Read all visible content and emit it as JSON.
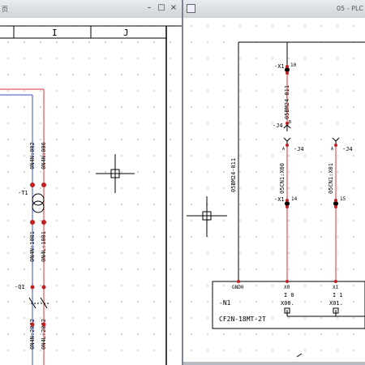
{
  "left_window": {
    "title_fragment": "页",
    "buttons": {
      "minimize": "–",
      "restore": "□",
      "close": "×"
    },
    "ruler": {
      "col_i": "I",
      "col_j": "J"
    },
    "labels": {
      "wire_top_1": "0N4N:002",
      "wire_top_2": "0N4N:006",
      "transformer": "-T1",
      "wire_mid_1": "0N4N:1001",
      "wire_mid_2": "0N4L:1001",
      "switch": "-Q1",
      "wire_bot_1": "0N4N:2002",
      "wire_bot_2": "0N4L:2002"
    }
  },
  "right_window": {
    "title": "05 - PLC",
    "labels": {
      "x1_top": "-X1",
      "pin_10": "10",
      "wire_vert": "05BM24-011",
      "j4_top": "-J4",
      "pin_b": "B",
      "j4_a": "-J4",
      "pin_a1": "A",
      "j4_a2": "-J4",
      "pin_a2": "A",
      "wire_x00": "05CN1:X00",
      "wire_x01": "05CN1:X01",
      "wire_left": "05BM24-011",
      "x1_mid": "-X1",
      "pin_14": "14",
      "pin_15": "15",
      "gnd": "GND0",
      "x0": "X0",
      "x1": "X1",
      "i0": "I 0",
      "i1": "I 1",
      "x00": "X00.",
      "x01": "X01.",
      "n1": "-N1",
      "plc_model": "CF2N-18MT-2T"
    }
  }
}
